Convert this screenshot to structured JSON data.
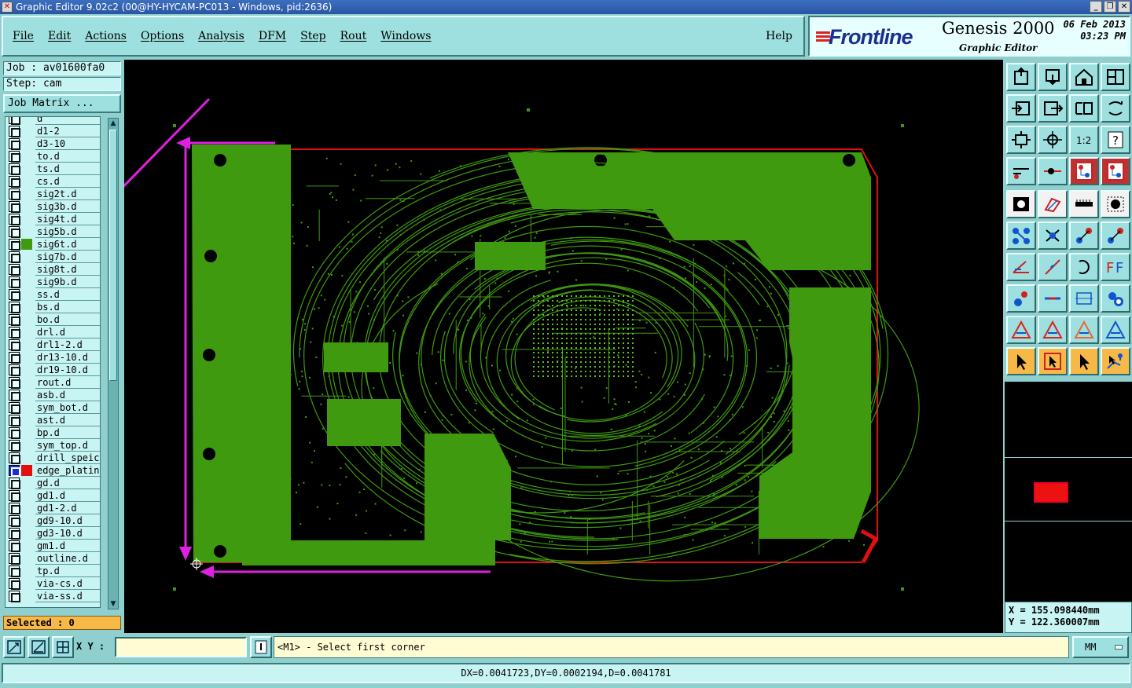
{
  "window": {
    "title": "Graphic Editor 9.02c2 (00@HY-HYCAM-PC013 - Windows, pid:2636)"
  },
  "menu": {
    "items": [
      "File",
      "Edit",
      "Actions",
      "Options",
      "Analysis",
      "DFM",
      "Step",
      "Rout",
      "Windows"
    ],
    "help": "Help"
  },
  "brand": {
    "logo": "Frontline",
    "product": "Genesis 2000",
    "subtitle": "Graphic Editor",
    "date": "06 Feb 2013",
    "time": "03:23 PM"
  },
  "job": {
    "job_label": "Job : av01600fa0",
    "step_label": "Step: cam",
    "matrix_button": "Job Matrix ..."
  },
  "layers": [
    {
      "name": "d",
      "color": ""
    },
    {
      "name": "d1-2",
      "color": ""
    },
    {
      "name": "d3-10",
      "color": ""
    },
    {
      "name": "to.d",
      "color": ""
    },
    {
      "name": "ts.d",
      "color": ""
    },
    {
      "name": "cs.d",
      "color": ""
    },
    {
      "name": "sig2t.d",
      "color": ""
    },
    {
      "name": "sig3b.d",
      "color": ""
    },
    {
      "name": "sig4t.d",
      "color": ""
    },
    {
      "name": "sig5b.d",
      "color": ""
    },
    {
      "name": "sig6t.d",
      "color": "#3f9a10"
    },
    {
      "name": "sig7b.d",
      "color": ""
    },
    {
      "name": "sig8t.d",
      "color": ""
    },
    {
      "name": "sig9b.d",
      "color": ""
    },
    {
      "name": "ss.d",
      "color": ""
    },
    {
      "name": "bs.d",
      "color": ""
    },
    {
      "name": "bo.d",
      "color": ""
    },
    {
      "name": "drl.d",
      "color": ""
    },
    {
      "name": "drl1-2.d",
      "color": ""
    },
    {
      "name": "dr13-10.d",
      "color": ""
    },
    {
      "name": "dr19-10.d",
      "color": ""
    },
    {
      "name": "rout.d",
      "color": ""
    },
    {
      "name": "asb.d",
      "color": ""
    },
    {
      "name": "sym_bot.d",
      "color": ""
    },
    {
      "name": "ast.d",
      "color": ""
    },
    {
      "name": "bp.d",
      "color": ""
    },
    {
      "name": "sym_top.d",
      "color": ""
    },
    {
      "name": "drill_speical",
      "color": ""
    },
    {
      "name": "edge_plating",
      "color": "#e11010",
      "selected": true
    },
    {
      "name": "gd.d",
      "color": ""
    },
    {
      "name": "gd1.d",
      "color": ""
    },
    {
      "name": "gd1-2.d",
      "color": ""
    },
    {
      "name": "gd9-10.d",
      "color": ""
    },
    {
      "name": "gd3-10.d",
      "color": ""
    },
    {
      "name": "gm1.d",
      "color": ""
    },
    {
      "name": "outline.d",
      "color": ""
    },
    {
      "name": "tp.d",
      "color": ""
    },
    {
      "name": "via-cs.d",
      "color": ""
    },
    {
      "name": "via-ss.d",
      "color": ""
    }
  ],
  "selected_count": "Selected : 0",
  "coords": {
    "x": "X = 155.098440mm",
    "y": "Y = 122.360007mm"
  },
  "bottom": {
    "xy_label": "X Y :",
    "xy_value": "",
    "prompt": "<M1> - Select first corner",
    "units": "MM",
    "status": "DX=0.0041723,DY=0.0002194,D=0.0041781"
  },
  "colors": {
    "panel": "#8fd0cf",
    "copper": "#3f9a10",
    "edge_plating": "#e11010",
    "annotation": "#e020e0"
  },
  "tool_icons": [
    "open-job-icon",
    "save-icon",
    "home-icon",
    "window-icon",
    "prev-step-icon",
    "next-step-icon",
    "swap-icon",
    "redraw-icon",
    "fit-icon",
    "center-icon",
    "scale-icon",
    "help-icon",
    "measure-icon",
    "snap-icon",
    "layer-up-icon",
    "layer-down-icon",
    "fill-icon",
    "outline-icon",
    "ruler-icon",
    "dots-icon",
    "add-pad-icon",
    "delete-icon",
    "move-icon",
    "copy-icon",
    "line-icon",
    "slash-icon",
    "arc-icon",
    "mirror-icon",
    "pad-icon",
    "resize-icon",
    "dimension-icon",
    "group-icon",
    "triangle-icon",
    "triangle-red-icon",
    "triangle-orange-icon",
    "triangle-blue-icon",
    "pointer-icon",
    "select-box-icon",
    "pointer-box-icon",
    "select-net-icon"
  ]
}
